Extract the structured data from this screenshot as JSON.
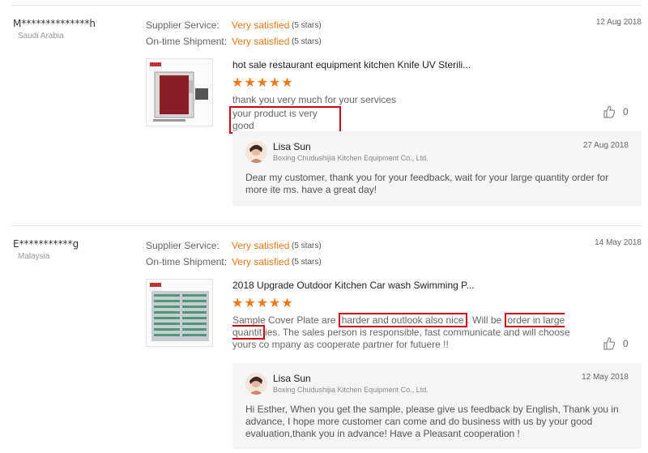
{
  "reviews": [
    {
      "buyer": "M**************h",
      "country": "Saudi Arabia",
      "date": "12 Aug 2018",
      "ratings": [
        {
          "label": "Supplier Service:",
          "value": "Very satisfied",
          "stars": "(5 stars)"
        },
        {
          "label": "On-time Shipment:",
          "value": "Very satisfied",
          "stars": "(5 stars)"
        }
      ],
      "product_title": "hot sale restaurant equipment kitchen Knife UV Sterili...",
      "stars": "★★★★★",
      "feedback_line1": "thank you very much for your services",
      "feedback_line2": "your product is very good",
      "likes": "0",
      "reply": {
        "name": "Lisa Sun",
        "company": "Boxing Chudushijia Kitchen Equipment Co., Ltd.",
        "date": "27 Aug 2018",
        "text": "Dear my customer, thank you for your feedback, wait for your large quantity order for more ite ms. have a great day!"
      }
    },
    {
      "buyer": "E***********g",
      "country": "Malaysia",
      "date": "14 May 2018",
      "ratings": [
        {
          "label": "Supplier Service:",
          "value": "Very satisfied",
          "stars": "(5 stars)"
        },
        {
          "label": "On-time Shipment:",
          "value": "Very satisfied",
          "stars": "(5 stars)"
        }
      ],
      "product_title": "2018 Upgrade Outdoor Kitchen Car wash Swimming P...",
      "stars": "★★★★★",
      "feedback_a": "Sample Cover Plate are ",
      "feedback_b": "harder and outlook also nice",
      "feedback_c": ". Will be ",
      "feedback_d": "order in large quantit",
      "feedback_e": "ies. The sales person is responsible, fast communicate and will choose yours co mpany as cooperate partner for futuere !!",
      "likes": "0",
      "reply": {
        "name": "Lisa Sun",
        "company": "Boxing Chudushijia Kitchen Equipment Co., Ltd.",
        "date": "12 May 2018",
        "text": "Hi Esther, When you get the sample, please give us feedback by English, Thank you in advance, I hope more customer can come and do business with us by your good evaluation,thank you in advance! Have a Pleasant cooperation !"
      }
    }
  ],
  "colors": {
    "accent": "#f07818",
    "highlight": "#d0021b"
  },
  "icons": {
    "like": "thumbs-up-icon"
  }
}
